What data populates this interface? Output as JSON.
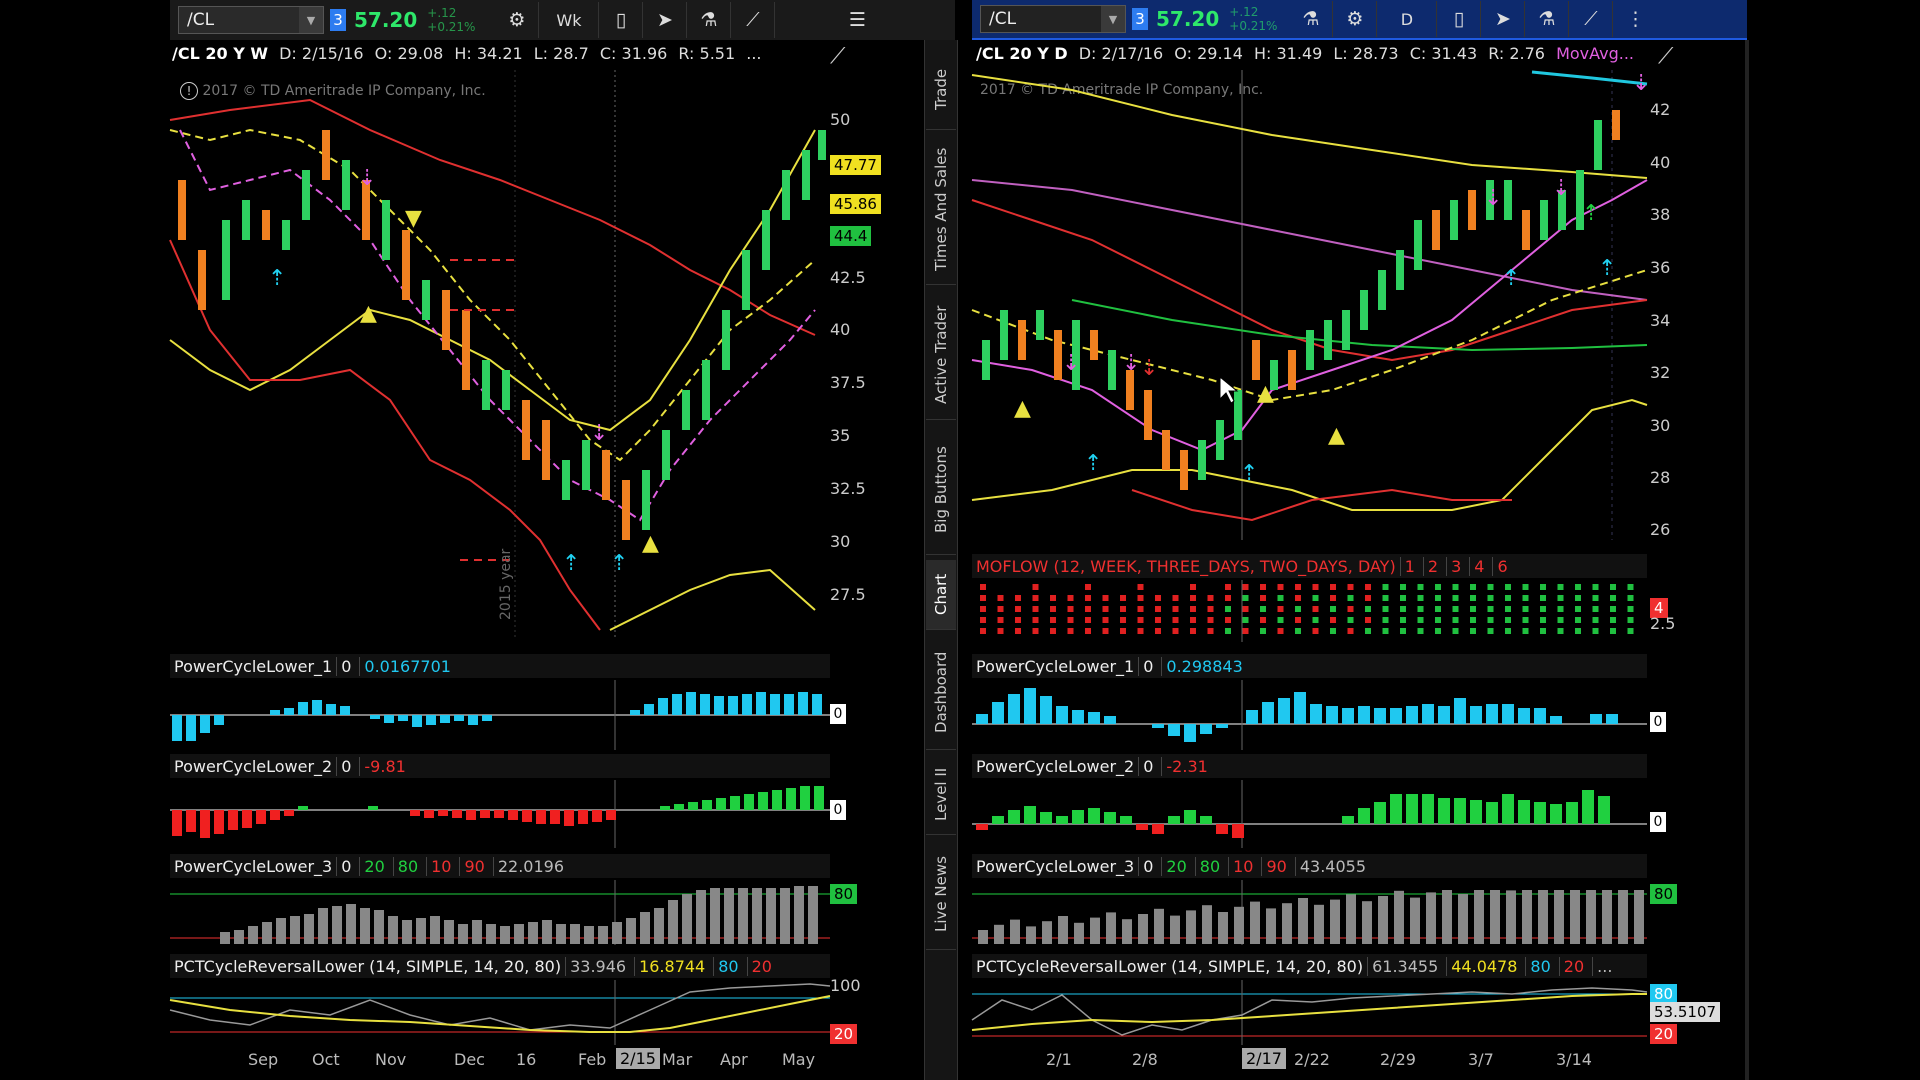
{
  "left": {
    "toolbar": {
      "symbol": "/CL",
      "link": "3",
      "price": "57.20",
      "change": "+.12",
      "change_pct": "+0.21%",
      "aggregation": "Wk"
    },
    "header": {
      "title": "/CL 20 Y W",
      "date": "D: 2/15/16",
      "open": "O: 29.08",
      "high": "H: 34.21",
      "low": "L: 28.7",
      "close": "C: 31.96",
      "range": "R: 5.51",
      "more": "..."
    },
    "copyright": "2017 © TD Ameritrade IP Company, Inc.",
    "price_axis": [
      "50",
      "42.5",
      "40",
      "37.5",
      "35",
      "32.5",
      "30",
      "27.5"
    ],
    "price_tags": [
      {
        "value": "47.77",
        "color": "#f0e020"
      },
      {
        "value": "45.86",
        "color": "#f0e020"
      },
      {
        "value": "44.4",
        "color": "#20c040"
      }
    ],
    "period_label": "2015 year",
    "studies": [
      {
        "name": "PowerCycleLower_1",
        "vals": [
          "0",
          "0.0167701"
        ],
        "zero": "0"
      },
      {
        "name": "PowerCycleLower_2",
        "vals": [
          "0",
          "-9.81"
        ],
        "zero": "0"
      },
      {
        "name": "PowerCycleLower_3",
        "vals": [
          "0",
          "20",
          "80",
          "10",
          "90",
          "22.0196"
        ],
        "tag": "80"
      },
      {
        "name": "PCTCycleReversalLower (14, SIMPLE, 14, 20, 80)",
        "vals": [
          "33.946",
          "16.8744",
          "80",
          "20"
        ],
        "top": "100",
        "tag": "20"
      }
    ],
    "x_axis": [
      "Sep",
      "Oct",
      "Nov",
      "Dec",
      "16",
      "Feb",
      "Mar",
      "Apr",
      "May"
    ],
    "x_selected": "2/15"
  },
  "right": {
    "toolbar": {
      "symbol": "/CL",
      "link": "3",
      "price": "57.20",
      "change": "+.12",
      "change_pct": "+0.21%",
      "aggregation": "D"
    },
    "header": {
      "title": "/CL 20 Y D",
      "date": "D: 2/17/16",
      "open": "O: 29.14",
      "high": "H: 31.49",
      "low": "L: 28.73",
      "close": "C: 31.43",
      "range": "R: 2.76",
      "study": "MovAvg..."
    },
    "copyright": "2017 © TD Ameritrade IP Company, Inc.",
    "price_axis": [
      "42",
      "40",
      "38",
      "36",
      "34",
      "32",
      "30",
      "28",
      "26"
    ],
    "moflow": {
      "label": "MOFLOW (12, WEEK, THREE_DAYS, TWO_DAYS, DAY)",
      "nums": [
        "1",
        "2",
        "3",
        "4",
        "6"
      ],
      "tag": "4",
      "axis": "2.5"
    },
    "studies": [
      {
        "name": "PowerCycleLower_1",
        "vals": [
          "0",
          "0.298843"
        ],
        "zero": "0"
      },
      {
        "name": "PowerCycleLower_2",
        "vals": [
          "0",
          "-2.31"
        ],
        "zero": "0"
      },
      {
        "name": "PowerCycleLower_3",
        "vals": [
          "0",
          "20",
          "80",
          "10",
          "90",
          "43.4055"
        ],
        "tag": "80"
      },
      {
        "name": "PCTCycleReversalLower (14, SIMPLE, 14, 20, 80)",
        "vals": [
          "61.3455",
          "44.0478",
          "80",
          "20",
          "..."
        ],
        "tag": "20",
        "tag2": "53.5107",
        "tag3": "80"
      }
    ],
    "x_axis": [
      "2/1",
      "2/8",
      "2/22",
      "2/29",
      "3/7",
      "3/14"
    ],
    "x_selected": "2/17"
  },
  "side_tabs": [
    "Trade",
    "Times And Sales",
    "Active Trader",
    "Big Buttons",
    "Chart",
    "Dashboard",
    "Level II",
    "Live News"
  ],
  "active_tab": "Chart"
}
